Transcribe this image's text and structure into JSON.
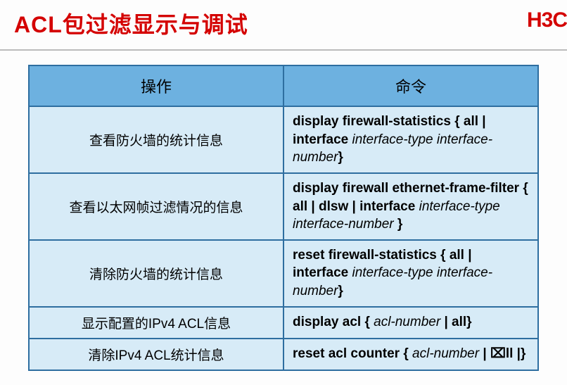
{
  "title": "ACL包过滤显示与调试",
  "logo": "H3C",
  "headers": {
    "op": "操作",
    "cmd": "命令"
  },
  "rows": [
    {
      "op": "查看防火墙的统计信息",
      "cmd_parts": [
        {
          "t": "display firewall-statistics { all | interface ",
          "s": "bold"
        },
        {
          "t": "interface-type interface-number",
          "s": "ital"
        },
        {
          "t": "}",
          "s": "bold"
        }
      ],
      "align": "left"
    },
    {
      "op": "查看以太网帧过滤情况的信息",
      "cmd_parts": [
        {
          "t": "display firewall ethernet-frame-filter { all | dlsw | interface ",
          "s": "bold"
        },
        {
          "t": "interface-type interface-number",
          "s": "ital"
        },
        {
          "t": " }",
          "s": "bold"
        }
      ],
      "align": "left"
    },
    {
      "op": "清除防火墙的统计信息",
      "cmd_parts": [
        {
          "t": "reset firewall-statistics { all | interface ",
          "s": "bold"
        },
        {
          "t": "interface-type interface-number",
          "s": "ital"
        },
        {
          "t": "}",
          "s": "bold"
        }
      ],
      "align": "left"
    },
    {
      "op": "显示配置的IPv4 ACL信息",
      "cmd_parts": [
        {
          "t": "display acl { ",
          "s": "bold"
        },
        {
          "t": "acl-number",
          "s": "ital"
        },
        {
          "t": " | ",
          "s": "bold"
        },
        {
          "t": "all",
          "s": "bold"
        },
        {
          "t": "}",
          "s": "bold"
        }
      ],
      "align": "center"
    },
    {
      "op": "清除IPv4 ACL统计信息",
      "cmd_parts": [
        {
          "t": "reset acl counter { ",
          "s": "bold"
        },
        {
          "t": "acl-number",
          "s": "ital"
        },
        {
          "t": " | ⌧ll |}",
          "s": "bold"
        }
      ],
      "align": "center"
    }
  ]
}
